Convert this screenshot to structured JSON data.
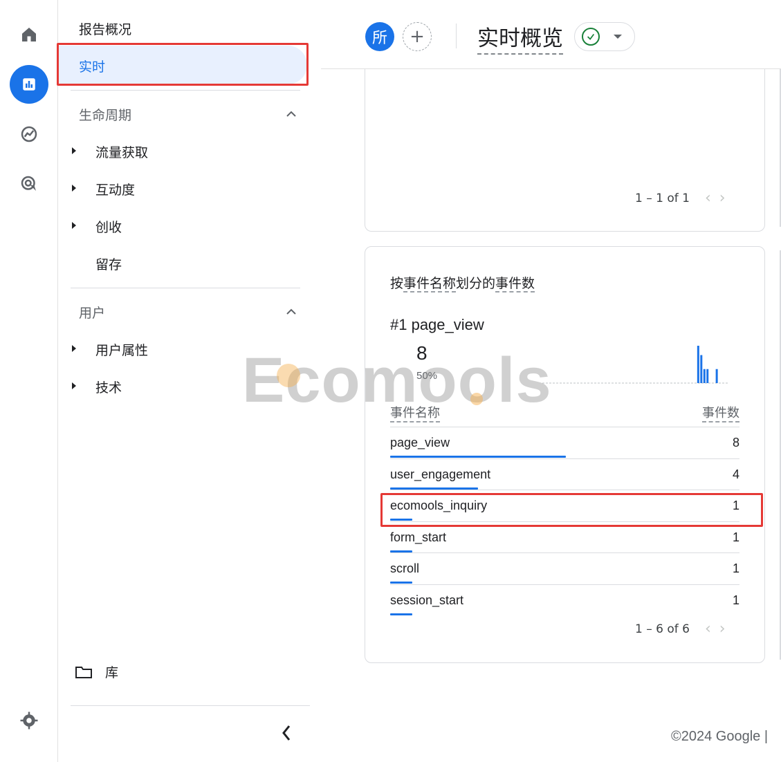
{
  "nav": {
    "overview": "报告概况",
    "realtime": "实时",
    "lifecycle": {
      "title": "生命周期",
      "items": [
        "流量获取",
        "互动度",
        "创收",
        "留存"
      ]
    },
    "user": {
      "title": "用户",
      "items": [
        "用户属性",
        "技术"
      ]
    },
    "library": "库"
  },
  "topbar": {
    "avatar": "所",
    "add": "+",
    "title": "实时概览"
  },
  "top_card": {
    "pager": "1 – 1 of 1"
  },
  "events_card": {
    "title_part1": "按",
    "title_part2": "事件名称",
    "title_part3": "划分的",
    "title_part4": "事件数",
    "rank": "#1  page_view",
    "top_value": "8",
    "top_pct": "50%",
    "col_name": "事件名称",
    "col_count": "事件数",
    "rows": [
      {
        "name": "page_view",
        "count": "8",
        "share": 1.0
      },
      {
        "name": "user_engagement",
        "count": "4",
        "share": 0.5
      },
      {
        "name": "ecomools_inquiry",
        "count": "1",
        "share": 0.125
      },
      {
        "name": "form_start",
        "count": "1",
        "share": 0.125
      },
      {
        "name": "scroll",
        "count": "1",
        "share": 0.125
      },
      {
        "name": "session_start",
        "count": "1",
        "share": 0.125
      }
    ],
    "pager": "1 – 6 of 6",
    "spark_values": [
      0,
      0,
      0,
      0,
      0,
      0,
      0,
      0,
      0,
      0,
      0,
      0,
      0,
      0,
      0,
      0,
      0,
      0,
      0,
      0,
      0,
      0,
      0,
      0,
      0,
      0,
      0,
      0,
      0,
      0,
      0,
      0,
      0,
      0,
      0,
      0,
      0,
      0,
      0,
      0,
      0,
      0,
      0,
      0,
      0,
      0,
      0,
      0,
      0,
      0,
      8,
      6,
      3,
      3,
      0,
      0,
      3,
      0,
      0,
      0
    ]
  },
  "watermark": "Ecomools",
  "footer": "©2024 Google |",
  "colors": {
    "accent": "#1a73e8",
    "highlight": "#e53935",
    "active_bg": "#e8f0fe"
  }
}
